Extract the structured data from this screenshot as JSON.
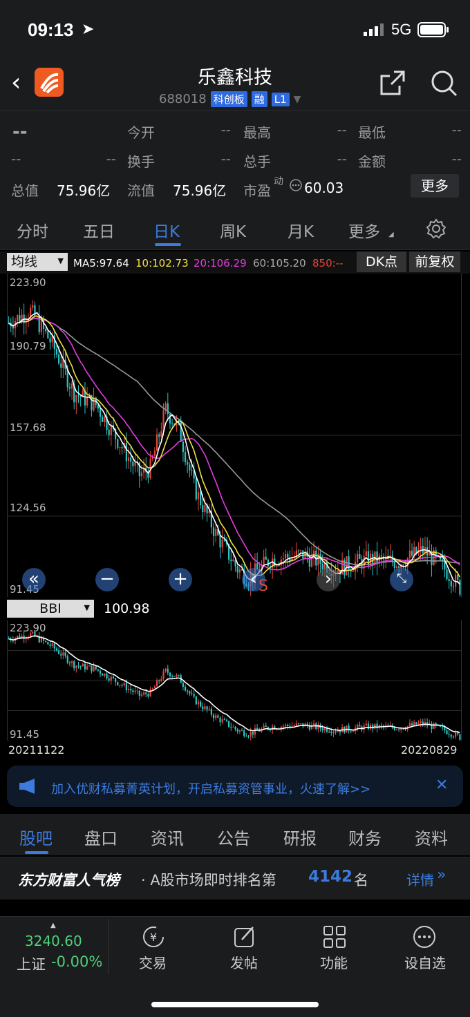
{
  "status": {
    "time": "09:13",
    "network": "5G"
  },
  "header": {
    "title": "乐鑫科技",
    "code": "688018",
    "tags": [
      "科创板",
      "融",
      "L1"
    ]
  },
  "quote": {
    "price": "--",
    "change1": "--",
    "change2": "--",
    "open_label": "今开",
    "open": "--",
    "high_label": "最高",
    "high": "--",
    "low_label": "最低",
    "low": "--",
    "turnover_label": "换手",
    "turnover": "--",
    "volume_label": "总手",
    "volume": "--",
    "amount_label": "金额",
    "amount": "--",
    "mcap_label": "总值",
    "mcap": "75.96亿",
    "float_label": "流值",
    "float": "75.96亿",
    "pe_label": "市盈",
    "pe_sup": "动",
    "pe": "60.03",
    "more": "更多"
  },
  "tabs": [
    "分时",
    "五日",
    "日K",
    "周K",
    "月K",
    "更多"
  ],
  "ma": {
    "selector": "均线",
    "ma5": "MA5:97.64",
    "ma10": "10:102.73",
    "ma20": "20:106.29",
    "ma60": "60:105.20",
    "ma850": "850:--",
    "dk": "DK点",
    "adjust": "前复权"
  },
  "main_axis": [
    "223.90",
    "190.79",
    "157.68",
    "124.56",
    "91.45"
  ],
  "bbi": {
    "selector": "BBI",
    "value": "100.98",
    "axis_top": "223.90",
    "axis_bottom": "91.45"
  },
  "dates": {
    "start": "20211122",
    "end": "20220829"
  },
  "signal": "S",
  "banner": {
    "text": "加入优财私募菁英计划，开启私募资管事业，火速了解>>"
  },
  "bottom_tabs": [
    "股吧",
    "盘口",
    "资讯",
    "公告",
    "研报",
    "财务",
    "资料"
  ],
  "rank": {
    "brand": "东方财富人气榜",
    "text": "· A股市场即时排名第",
    "number": "4142",
    "suffix": "名",
    "details": "详情"
  },
  "index": {
    "value": "3240.60",
    "name": "上证",
    "change": "-0.00%"
  },
  "tabbar": [
    "交易",
    "发帖",
    "功能",
    "设自选"
  ],
  "colors": {
    "up": "#e8453c",
    "down": "#2fc4c4",
    "ma5": "#ffffff",
    "ma10": "#f4e04a",
    "ma20": "#e23ee0",
    "ma60": "#999999",
    "accent": "#3c7bdc"
  }
}
